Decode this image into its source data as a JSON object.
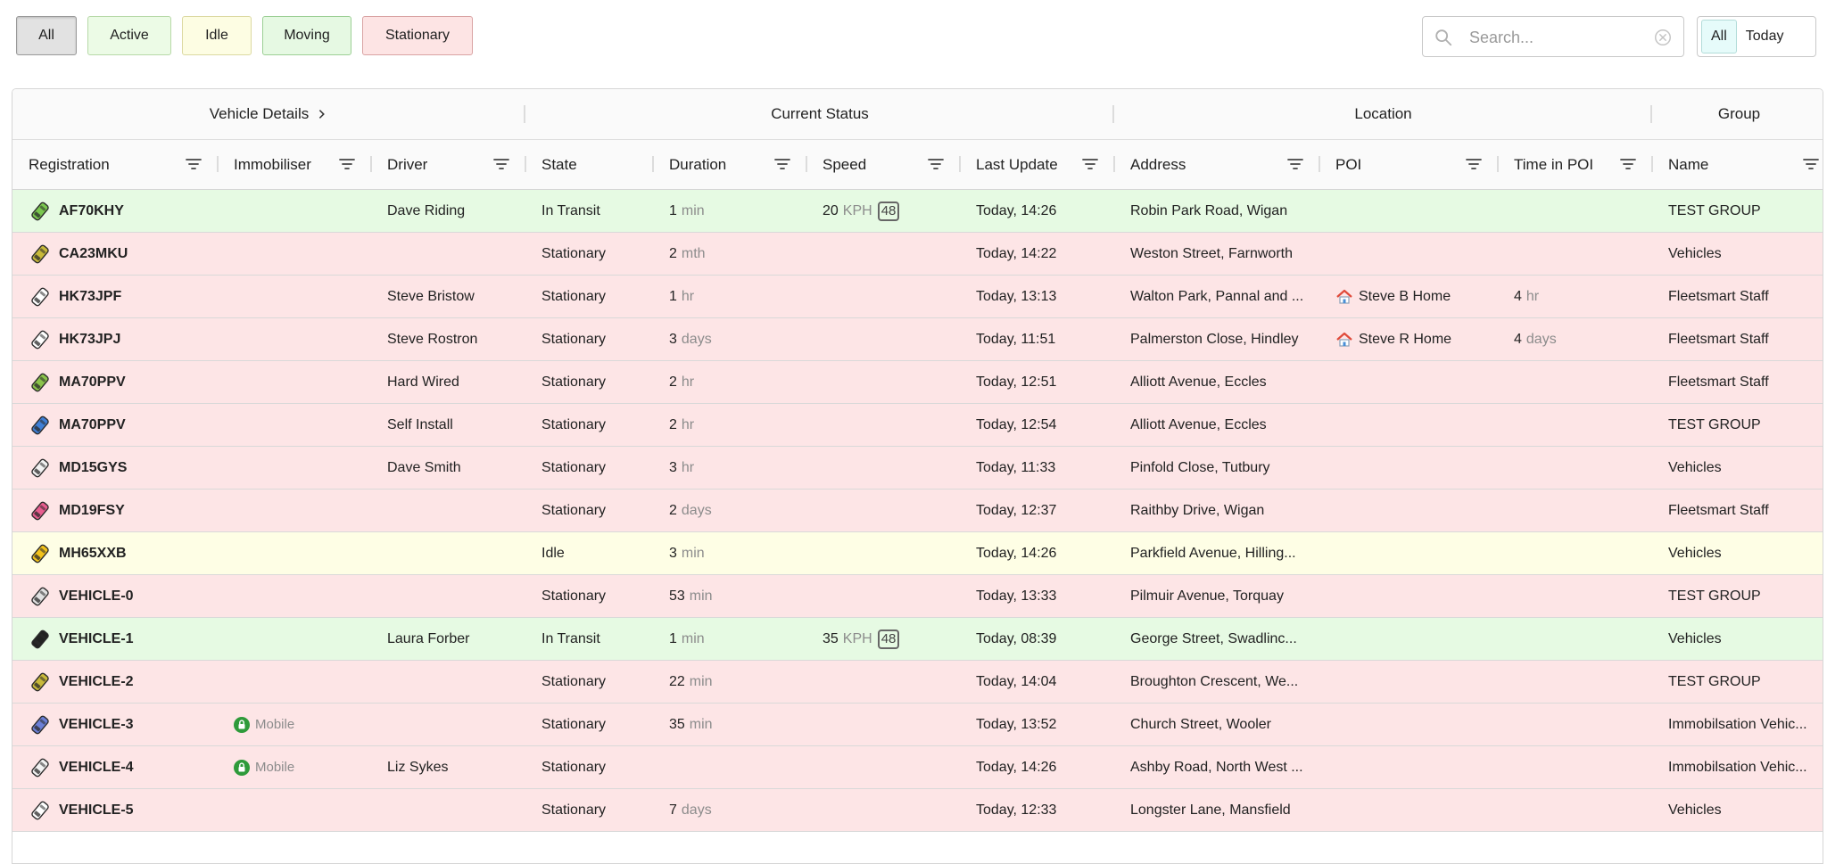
{
  "filters": [
    {
      "id": "all",
      "label": "All",
      "selected": true
    },
    {
      "id": "active",
      "label": "Active"
    },
    {
      "id": "idle",
      "label": "Idle"
    },
    {
      "id": "moving",
      "label": "Moving"
    },
    {
      "id": "stationary",
      "label": "Stationary"
    }
  ],
  "search": {
    "placeholder": "Search...",
    "value": ""
  },
  "period": [
    {
      "label": "All",
      "selected": true
    },
    {
      "label": "Today"
    }
  ],
  "column_groups": [
    "Vehicle Details",
    "Current Status",
    "Location",
    "Group"
  ],
  "columns": [
    "Registration",
    "Immobiliser",
    "Driver",
    "State",
    "Duration",
    "Speed",
    "Last Update",
    "Address",
    "POI",
    "Time in POI",
    "Name"
  ],
  "colors": {
    "active_row": "#e6fae3",
    "stationary_row": "#fde5e6",
    "idle_row": "#fefee5"
  },
  "rows": [
    {
      "status": "active",
      "icon_color": "#7ac74f",
      "registration": "AF70KHY",
      "immobiliser": "",
      "driver": "Dave Riding",
      "state": "In Transit",
      "duration_value": "1",
      "duration_unit": "min",
      "speed_value": "20",
      "speed_unit": "KPH",
      "speed_limit": "48",
      "last_update": "Today, 14:26",
      "address": "Robin Park Road, Wigan",
      "poi": "",
      "time_poi_value": "",
      "time_poi_unit": "",
      "group": "TEST GROUP"
    },
    {
      "status": "stationary",
      "icon_color": "#c8b93a",
      "registration": "CA23MKU",
      "immobiliser": "",
      "driver": "",
      "state": "Stationary",
      "duration_value": "2",
      "duration_unit": "mth",
      "speed_value": "",
      "speed_unit": "",
      "speed_limit": "",
      "last_update": "Today, 14:22",
      "address": "Weston Street, Farnworth",
      "poi": "",
      "time_poi_value": "",
      "time_poi_unit": "",
      "group": "Vehicles"
    },
    {
      "status": "stationary",
      "icon_color": "#ffffff",
      "registration": "HK73JPF",
      "immobiliser": "",
      "driver": "Steve Bristow",
      "state": "Stationary",
      "duration_value": "1",
      "duration_unit": "hr",
      "speed_value": "",
      "speed_unit": "",
      "speed_limit": "",
      "last_update": "Today, 13:13",
      "address": "Walton Park, Pannal and ...",
      "poi": "Steve B Home",
      "time_poi_value": "4",
      "time_poi_unit": "hr",
      "group": "Fleetsmart Staff"
    },
    {
      "status": "stationary",
      "icon_color": "#ffffff",
      "registration": "HK73JPJ",
      "immobiliser": "",
      "driver": "Steve Rostron",
      "state": "Stationary",
      "duration_value": "3",
      "duration_unit": "days",
      "speed_value": "",
      "speed_unit": "",
      "speed_limit": "",
      "last_update": "Today, 11:51",
      "address": "Palmerston Close, Hindley",
      "poi": "Steve R Home",
      "time_poi_value": "4",
      "time_poi_unit": "days",
      "group": "Fleetsmart Staff"
    },
    {
      "status": "stationary",
      "icon_color": "#8bc34a",
      "registration": "MA70PPV",
      "immobiliser": "",
      "driver": "Hard Wired",
      "state": "Stationary",
      "duration_value": "2",
      "duration_unit": "hr",
      "speed_value": "",
      "speed_unit": "",
      "speed_limit": "",
      "last_update": "Today, 12:51",
      "address": "Alliott Avenue, Eccles",
      "poi": "",
      "time_poi_value": "",
      "time_poi_unit": "",
      "group": "Fleetsmart Staff"
    },
    {
      "status": "stationary",
      "icon_color": "#3f7fd6",
      "registration": "MA70PPV",
      "immobiliser": "",
      "driver": "Self Install",
      "state": "Stationary",
      "duration_value": "2",
      "duration_unit": "hr",
      "speed_value": "",
      "speed_unit": "",
      "speed_limit": "",
      "last_update": "Today, 12:54",
      "address": "Alliott Avenue, Eccles",
      "poi": "",
      "time_poi_value": "",
      "time_poi_unit": "",
      "group": "TEST GROUP"
    },
    {
      "status": "stationary",
      "icon_color": "#f2f2f2",
      "registration": "MD15GYS",
      "immobiliser": "",
      "driver": "Dave Smith",
      "state": "Stationary",
      "duration_value": "3",
      "duration_unit": "hr",
      "speed_value": "",
      "speed_unit": "",
      "speed_limit": "",
      "last_update": "Today, 11:33",
      "address": "Pinfold Close, Tutbury",
      "poi": "",
      "time_poi_value": "",
      "time_poi_unit": "",
      "group": "Vehicles"
    },
    {
      "status": "stationary",
      "icon_color": "#e85d8f",
      "registration": "MD19FSY",
      "immobiliser": "",
      "driver": "",
      "state": "Stationary",
      "duration_value": "2",
      "duration_unit": "days",
      "speed_value": "",
      "speed_unit": "",
      "speed_limit": "",
      "last_update": "Today, 12:37",
      "address": "Raithby Drive, Wigan",
      "poi": "",
      "time_poi_value": "",
      "time_poi_unit": "",
      "group": "Fleetsmart Staff"
    },
    {
      "status": "idle",
      "icon_color": "#f2c21b",
      "registration": "MH65XXB",
      "immobiliser": "",
      "driver": "",
      "state": "Idle",
      "duration_value": "3",
      "duration_unit": "min",
      "speed_value": "",
      "speed_unit": "",
      "speed_limit": "",
      "last_update": "Today, 14:26",
      "address": "Parkfield Avenue, Hilling...",
      "poi": "",
      "time_poi_value": "",
      "time_poi_unit": "",
      "group": "Vehicles"
    },
    {
      "status": "stationary",
      "icon_color": "#e0e0e0",
      "registration": "VEHICLE-0",
      "immobiliser": "",
      "driver": "",
      "state": "Stationary",
      "duration_value": "53",
      "duration_unit": "min",
      "speed_value": "",
      "speed_unit": "",
      "speed_limit": "",
      "last_update": "Today, 13:33",
      "address": "Pilmuir Avenue, Torquay",
      "poi": "",
      "time_poi_value": "",
      "time_poi_unit": "",
      "group": "TEST GROUP"
    },
    {
      "status": "active",
      "icon_color": "#222222",
      "registration": "VEHICLE-1",
      "immobiliser": "",
      "driver": "Laura Forber",
      "state": "In Transit",
      "duration_value": "1",
      "duration_unit": "min",
      "speed_value": "35",
      "speed_unit": "KPH",
      "speed_limit": "48",
      "last_update": "Today, 08:39",
      "address": "George Street, Swadlinc...",
      "poi": "",
      "time_poi_value": "",
      "time_poi_unit": "",
      "group": "Vehicles"
    },
    {
      "status": "stationary",
      "icon_color": "#c8b93a",
      "registration": "VEHICLE-2",
      "immobiliser": "",
      "driver": "",
      "state": "Stationary",
      "duration_value": "22",
      "duration_unit": "min",
      "speed_value": "",
      "speed_unit": "",
      "speed_limit": "",
      "last_update": "Today, 14:04",
      "address": "Broughton Crescent, We...",
      "poi": "",
      "time_poi_value": "",
      "time_poi_unit": "",
      "group": "TEST GROUP"
    },
    {
      "status": "stationary",
      "icon_color": "#6b7fd6",
      "registration": "VEHICLE-3",
      "immobiliser": "Mobile",
      "driver": "",
      "state": "Stationary",
      "duration_value": "35",
      "duration_unit": "min",
      "speed_value": "",
      "speed_unit": "",
      "speed_limit": "",
      "last_update": "Today, 13:52",
      "address": "Church Street, Wooler",
      "poi": "",
      "time_poi_value": "",
      "time_poi_unit": "",
      "group": "Immobilsation Vehic..."
    },
    {
      "status": "stationary",
      "icon_color": "#f2f2f2",
      "registration": "VEHICLE-4",
      "immobiliser": "Mobile",
      "driver": "Liz Sykes",
      "state": "Stationary",
      "duration_value": "",
      "duration_unit": "",
      "speed_value": "",
      "speed_unit": "",
      "speed_limit": "",
      "last_update": "Today, 14:26",
      "address": "Ashby Road, North West ...",
      "poi": "",
      "time_poi_value": "",
      "time_poi_unit": "",
      "group": "Immobilsation Vehic..."
    },
    {
      "status": "stationary",
      "icon_color": "#ffffff",
      "registration": "VEHICLE-5",
      "immobiliser": "",
      "driver": "",
      "state": "Stationary",
      "duration_value": "7",
      "duration_unit": "days",
      "speed_value": "",
      "speed_unit": "",
      "speed_limit": "",
      "last_update": "Today, 12:33",
      "address": "Longster Lane, Mansfield",
      "poi": "",
      "time_poi_value": "",
      "time_poi_unit": "",
      "group": "Vehicles"
    }
  ]
}
